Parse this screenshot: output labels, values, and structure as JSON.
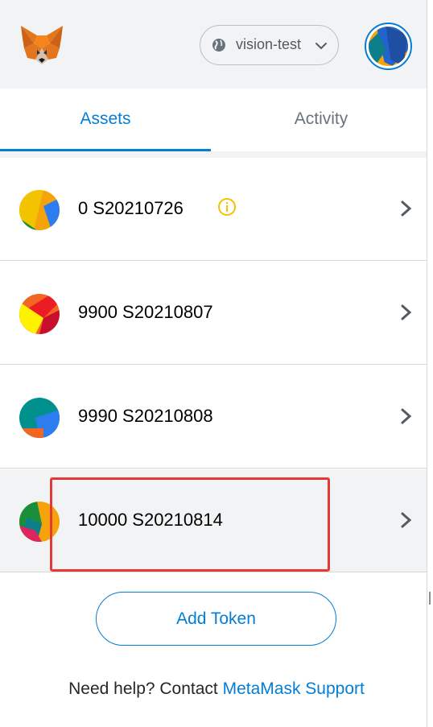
{
  "header": {
    "network_label": "vision-test"
  },
  "tabs": [
    {
      "label": "Assets",
      "active": true
    },
    {
      "label": "Activity",
      "active": false
    }
  ],
  "assets": [
    {
      "amount": "0 S20210726",
      "warning": true
    },
    {
      "amount": "9900 S20210807",
      "warning": false
    },
    {
      "amount": "9990 S20210808",
      "warning": false
    },
    {
      "amount": "10000 S20210814",
      "warning": false,
      "highlighted": true
    }
  ],
  "add_token_label": "Add Token",
  "help": {
    "text": "Need help? Contact ",
    "link": "MetaMask Support"
  },
  "colors": {
    "accent": "#037dd6",
    "highlight": "#e53935",
    "warning": "#f8c000"
  }
}
